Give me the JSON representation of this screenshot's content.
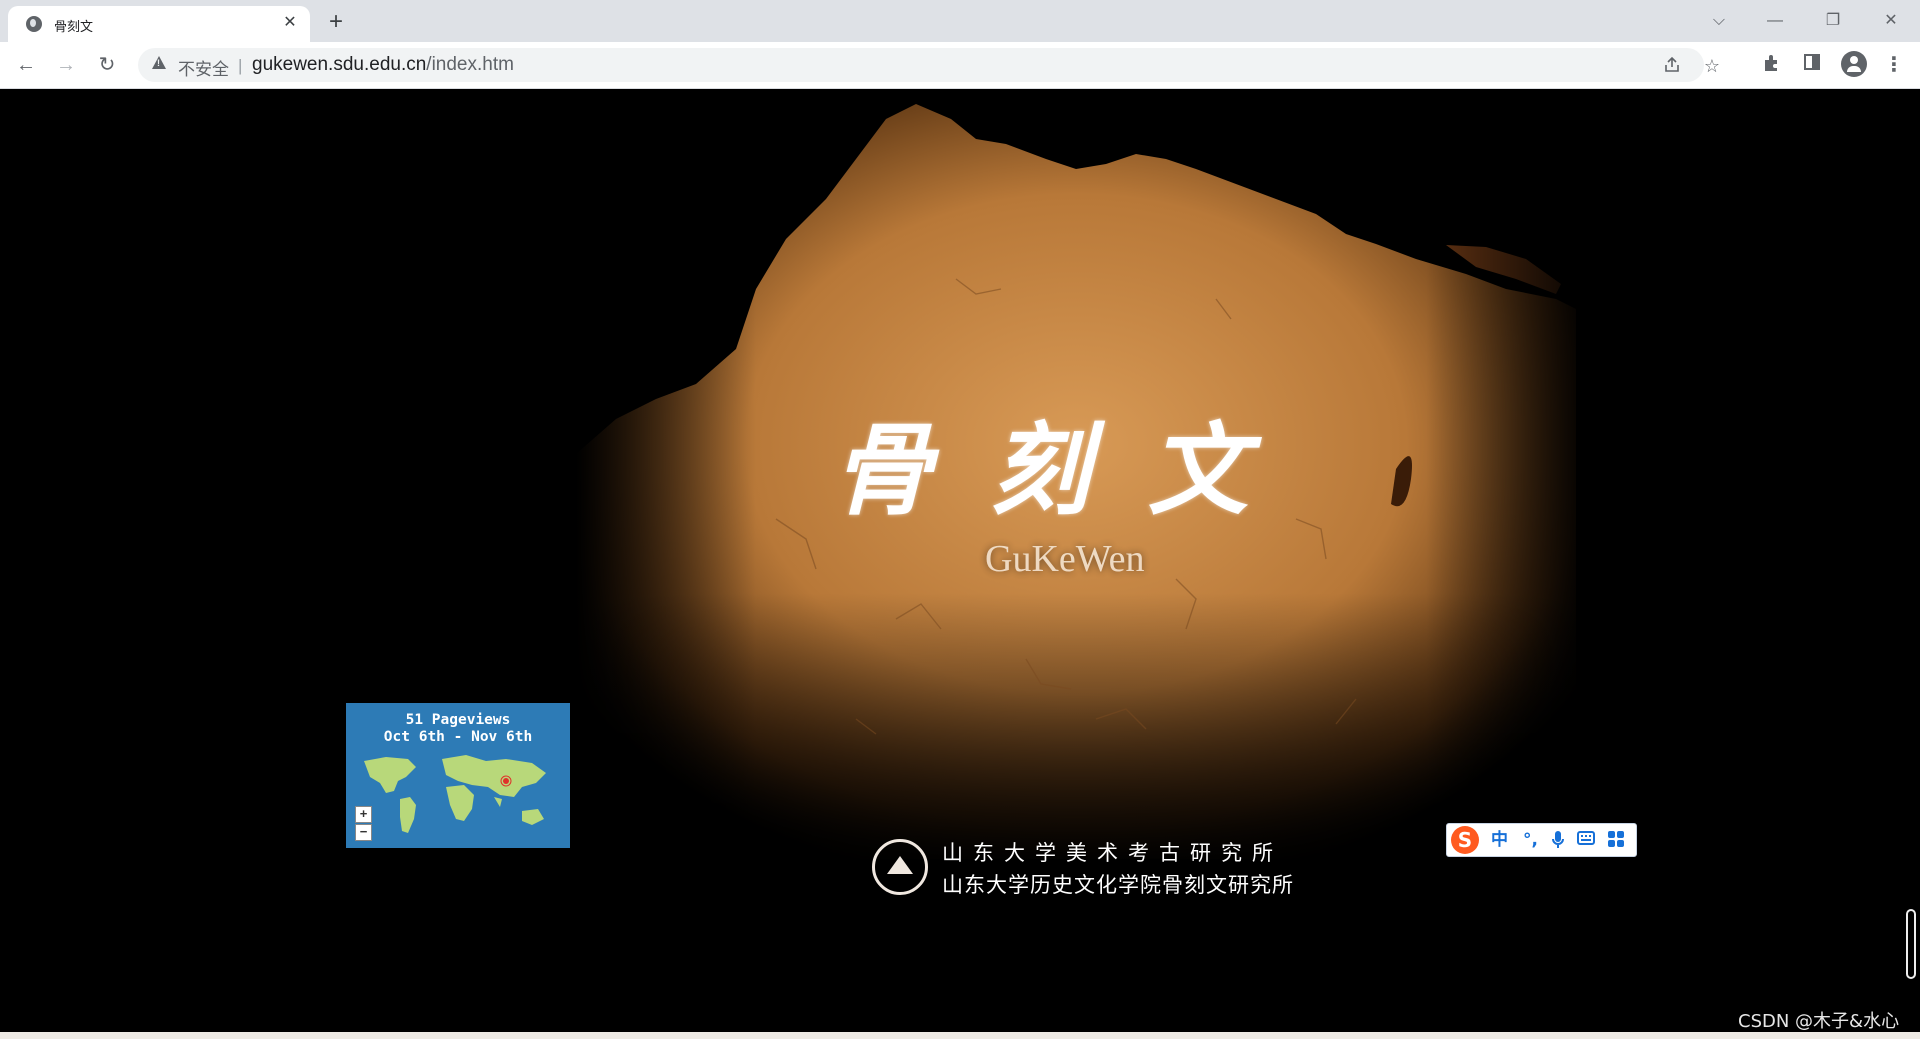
{
  "browser": {
    "tab_title": "骨刻文",
    "tab_close": "✕",
    "new_tab": "+",
    "window_controls": {
      "dropdown": "⌵",
      "minimize": "—",
      "restore": "❐",
      "close": "✕"
    },
    "nav": {
      "back": "←",
      "forward": "→",
      "reload": "↻"
    },
    "address": {
      "security_label": "不安全",
      "separator": "|",
      "host": "gukewen.sdu.edu.cn",
      "path": "/index.htm"
    },
    "omnibox_icons": [
      "share-icon",
      "bookmark-star-icon"
    ],
    "toolbar_icons": [
      "extensions-icon",
      "side-panel-icon",
      "profile-icon",
      "menu-icon"
    ]
  },
  "page": {
    "title_chars": "骨刻文",
    "subtitle": "GuKeWen",
    "institute_line1": "山东大学美术考古研究所",
    "institute_line2": "山东大学历史文化学院骨刻文研究所",
    "background_color": "#000000",
    "bone_color": "#c98a48"
  },
  "counter_widget": {
    "line1": "51 Pageviews",
    "line2": "Oct 6th - Nov 6th",
    "zoom_in": "+",
    "zoom_out": "−",
    "ocean_color": "#2d7bb6",
    "land_color": "#b8d87a"
  },
  "ime_toolbar": {
    "logo": "S",
    "mode": "中",
    "punct": "°,",
    "icons": [
      "microphone-icon",
      "keyboard-icon",
      "toolbox-icon"
    ]
  },
  "watermark": "CSDN @木子&水心"
}
